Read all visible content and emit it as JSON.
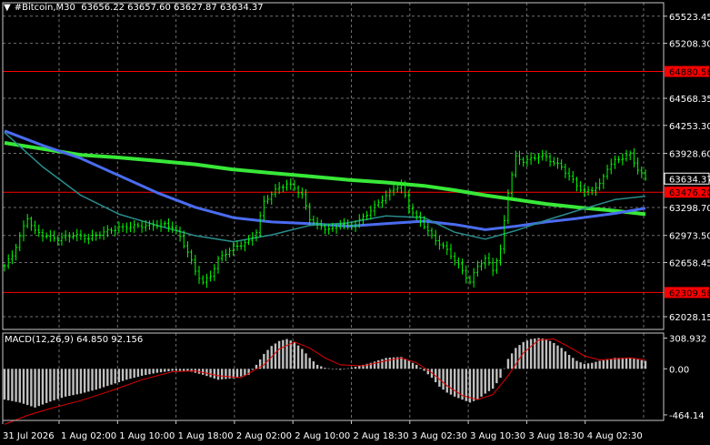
{
  "header": {
    "menu_arrow": "▼",
    "symbol_timeframe": "#Bitcoin,M30",
    "ohlc": "63656.22 63657.60 63627.87 63634.37"
  },
  "macd_header": "MACD(12,26,9) 64.850 92.156",
  "colors": {
    "background": "#000000",
    "grid": "#c8c8c8",
    "candle": "#00ff00",
    "ma_fast": "#2a8c8c",
    "ma_mid": "#4a6cf0",
    "ma_slow": "#38e838",
    "level_line": "#ff0000",
    "level_tag_bg": "#ff0000",
    "macd_hist": "#c0c0c0",
    "macd_signal": "#e00000"
  },
  "chart_data": {
    "type": "candlestick",
    "y_range": [
      61880,
      65680
    ],
    "price_ticks": [
      "65523.45",
      "65208.30",
      "64568.35",
      "64253.30",
      "63928.60",
      "63298.70",
      "62973.50",
      "62658.45",
      "62028.15"
    ],
    "price_tick_values": [
      65523.45,
      65208.3,
      64568.35,
      64253.3,
      63928.6,
      63298.7,
      62973.5,
      62658.45,
      62028.15
    ],
    "current_price": "63634.37",
    "current_price_value": 63634.37,
    "levels": [
      {
        "label": "64880.58",
        "value": 64880.58
      },
      {
        "label": "63476.20",
        "value": 63476.2
      },
      {
        "label": "62309.58",
        "value": 62309.58
      }
    ],
    "time_labels": [
      "31 Jul 2026",
      "1 Aug 02:00",
      "1 Aug 10:00",
      "1 Aug 18:00",
      "2 Aug 02:00",
      "2 Aug 10:00",
      "2 Aug 18:30",
      "3 Aug 02:30",
      "3 Aug 10:30",
      "3 Aug 18:30",
      "4 Aug 02:30"
    ],
    "close_path": [
      [
        0,
        62620
      ],
      [
        2,
        62740
      ],
      [
        4,
        62960
      ],
      [
        6,
        63180
      ],
      [
        8,
        63020
      ],
      [
        10,
        62980
      ],
      [
        14,
        62930
      ],
      [
        18,
        62980
      ],
      [
        22,
        62940
      ],
      [
        26,
        63010
      ],
      [
        30,
        63060
      ],
      [
        34,
        63080
      ],
      [
        38,
        63090
      ],
      [
        42,
        63100
      ],
      [
        44,
        63070
      ],
      [
        46,
        62960
      ],
      [
        48,
        62780
      ],
      [
        50,
        62560
      ],
      [
        52,
        62420
      ],
      [
        54,
        62510
      ],
      [
        56,
        62690
      ],
      [
        58,
        62770
      ],
      [
        60,
        62830
      ],
      [
        62,
        62870
      ],
      [
        64,
        62900
      ],
      [
        66,
        63020
      ],
      [
        68,
        63360
      ],
      [
        70,
        63460
      ],
      [
        72,
        63530
      ],
      [
        74,
        63570
      ],
      [
        76,
        63530
      ],
      [
        78,
        63440
      ],
      [
        80,
        63170
      ],
      [
        82,
        63090
      ],
      [
        84,
        63060
      ],
      [
        86,
        63040
      ],
      [
        88,
        63120
      ],
      [
        90,
        63080
      ],
      [
        92,
        63100
      ],
      [
        94,
        63190
      ],
      [
        96,
        63260
      ],
      [
        98,
        63360
      ],
      [
        100,
        63430
      ],
      [
        102,
        63520
      ],
      [
        104,
        63560
      ],
      [
        106,
        63300
      ],
      [
        108,
        63180
      ],
      [
        110,
        63090
      ],
      [
        112,
        62960
      ],
      [
        114,
        62880
      ],
      [
        116,
        62800
      ],
      [
        118,
        62690
      ],
      [
        120,
        62560
      ],
      [
        122,
        62430
      ],
      [
        124,
        62620
      ],
      [
        126,
        62700
      ],
      [
        128,
        62580
      ],
      [
        130,
        62800
      ],
      [
        132,
        63480
      ],
      [
        134,
        63880
      ],
      [
        136,
        63840
      ],
      [
        138,
        63860
      ],
      [
        140,
        63900
      ],
      [
        142,
        63880
      ],
      [
        144,
        63820
      ],
      [
        146,
        63770
      ],
      [
        148,
        63660
      ],
      [
        150,
        63560
      ],
      [
        152,
        63470
      ],
      [
        154,
        63510
      ],
      [
        156,
        63560
      ],
      [
        158,
        63760
      ],
      [
        160,
        63840
      ],
      [
        162,
        63880
      ],
      [
        164,
        63920
      ],
      [
        166,
        63740
      ],
      [
        168,
        63630
      ]
    ],
    "ma_fast": [
      [
        0,
        64170
      ],
      [
        10,
        63770
      ],
      [
        20,
        63440
      ],
      [
        30,
        63220
      ],
      [
        40,
        63090
      ],
      [
        50,
        62970
      ],
      [
        60,
        62900
      ],
      [
        70,
        62980
      ],
      [
        80,
        63090
      ],
      [
        90,
        63120
      ],
      [
        100,
        63200
      ],
      [
        110,
        63180
      ],
      [
        118,
        63010
      ],
      [
        126,
        62930
      ],
      [
        134,
        63030
      ],
      [
        142,
        63150
      ],
      [
        150,
        63260
      ],
      [
        160,
        63390
      ],
      [
        168,
        63430
      ]
    ],
    "ma_mid": [
      [
        0,
        64190
      ],
      [
        10,
        64020
      ],
      [
        20,
        63870
      ],
      [
        30,
        63670
      ],
      [
        40,
        63470
      ],
      [
        50,
        63300
      ],
      [
        60,
        63180
      ],
      [
        70,
        63130
      ],
      [
        80,
        63110
      ],
      [
        90,
        63080
      ],
      [
        100,
        63110
      ],
      [
        110,
        63140
      ],
      [
        118,
        63100
      ],
      [
        126,
        63040
      ],
      [
        134,
        63080
      ],
      [
        142,
        63130
      ],
      [
        150,
        63170
      ],
      [
        160,
        63230
      ],
      [
        168,
        63290
      ]
    ],
    "ma_slow": [
      [
        0,
        64050
      ],
      [
        10,
        63980
      ],
      [
        20,
        63910
      ],
      [
        30,
        63880
      ],
      [
        40,
        63840
      ],
      [
        50,
        63800
      ],
      [
        60,
        63740
      ],
      [
        70,
        63700
      ],
      [
        80,
        63660
      ],
      [
        90,
        63620
      ],
      [
        100,
        63590
      ],
      [
        110,
        63550
      ],
      [
        118,
        63500
      ],
      [
        126,
        63440
      ],
      [
        134,
        63390
      ],
      [
        142,
        63340
      ],
      [
        150,
        63300
      ],
      [
        160,
        63260
      ],
      [
        168,
        63220
      ]
    ],
    "macd": {
      "ticks": [
        "308.932",
        "0.00",
        "-464.14"
      ],
      "tick_values": [
        308.932,
        0.0,
        -464.14
      ],
      "y_range": [
        -520,
        360
      ],
      "histogram": [
        [
          0,
          -310
        ],
        [
          4,
          -340
        ],
        [
          8,
          -390
        ],
        [
          12,
          -330
        ],
        [
          16,
          -280
        ],
        [
          20,
          -250
        ],
        [
          24,
          -210
        ],
        [
          28,
          -160
        ],
        [
          32,
          -110
        ],
        [
          36,
          -70
        ],
        [
          40,
          -40
        ],
        [
          44,
          -20
        ],
        [
          48,
          -20
        ],
        [
          52,
          -60
        ],
        [
          56,
          -110
        ],
        [
          60,
          -95
        ],
        [
          64,
          -60
        ],
        [
          66,
          40
        ],
        [
          68,
          150
        ],
        [
          70,
          230
        ],
        [
          72,
          280
        ],
        [
          74,
          300
        ],
        [
          76,
          270
        ],
        [
          78,
          200
        ],
        [
          80,
          110
        ],
        [
          82,
          40
        ],
        [
          84,
          10
        ],
        [
          86,
          0
        ],
        [
          88,
          -10
        ],
        [
          92,
          20
        ],
        [
          96,
          60
        ],
        [
          100,
          110
        ],
        [
          104,
          120
        ],
        [
          106,
          80
        ],
        [
          108,
          40
        ],
        [
          110,
          -20
        ],
        [
          112,
          -90
        ],
        [
          114,
          -180
        ],
        [
          116,
          -240
        ],
        [
          118,
          -280
        ],
        [
          120,
          -310
        ],
        [
          122,
          -340
        ],
        [
          124,
          -310
        ],
        [
          126,
          -250
        ],
        [
          128,
          -200
        ],
        [
          130,
          -90
        ],
        [
          132,
          100
        ],
        [
          134,
          210
        ],
        [
          136,
          270
        ],
        [
          138,
          300
        ],
        [
          140,
          310
        ],
        [
          142,
          300
        ],
        [
          144,
          260
        ],
        [
          146,
          210
        ],
        [
          148,
          140
        ],
        [
          150,
          80
        ],
        [
          152,
          50
        ],
        [
          154,
          60
        ],
        [
          156,
          80
        ],
        [
          158,
          90
        ],
        [
          160,
          110
        ],
        [
          164,
          110
        ],
        [
          168,
          80
        ]
      ],
      "signal": [
        [
          0,
          -560
        ],
        [
          6,
          -470
        ],
        [
          12,
          -400
        ],
        [
          20,
          -320
        ],
        [
          28,
          -220
        ],
        [
          36,
          -110
        ],
        [
          44,
          -30
        ],
        [
          50,
          -20
        ],
        [
          56,
          -70
        ],
        [
          62,
          -90
        ],
        [
          68,
          40
        ],
        [
          72,
          200
        ],
        [
          76,
          270
        ],
        [
          80,
          210
        ],
        [
          84,
          110
        ],
        [
          88,
          40
        ],
        [
          94,
          30
        ],
        [
          100,
          80
        ],
        [
          104,
          110
        ],
        [
          108,
          60
        ],
        [
          112,
          -40
        ],
        [
          116,
          -170
        ],
        [
          120,
          -270
        ],
        [
          124,
          -310
        ],
        [
          128,
          -260
        ],
        [
          132,
          -70
        ],
        [
          136,
          160
        ],
        [
          140,
          290
        ],
        [
          144,
          300
        ],
        [
          148,
          220
        ],
        [
          152,
          130
        ],
        [
          156,
          90
        ],
        [
          160,
          100
        ],
        [
          164,
          110
        ],
        [
          168,
          90
        ]
      ]
    }
  }
}
